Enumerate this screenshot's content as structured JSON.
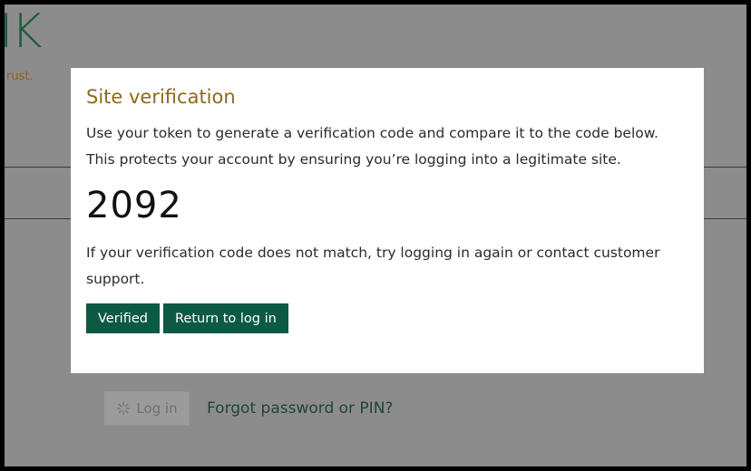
{
  "background": {
    "logo_text": "IK",
    "tagline": "rust.",
    "login_button_label": "Log in",
    "forgot_link": "Forgot password or PIN?"
  },
  "modal": {
    "title": "Site verification",
    "description": "Use your token to generate a verification code and compare it to the code below. This protects your account by ensuring you’re logging into a legitimate site.",
    "code": "2092",
    "mismatch_text": "If your verification code does not match, try logging in again or contact customer support.",
    "buttons": {
      "verified": "Verified",
      "return": "Return to log in"
    }
  },
  "colors": {
    "brand_green": "#0c5a44",
    "title_gold": "#8c6a1c",
    "overlay_gray": "#8c8c8c"
  },
  "icons": {
    "login_spinner": "spinner-icon"
  }
}
